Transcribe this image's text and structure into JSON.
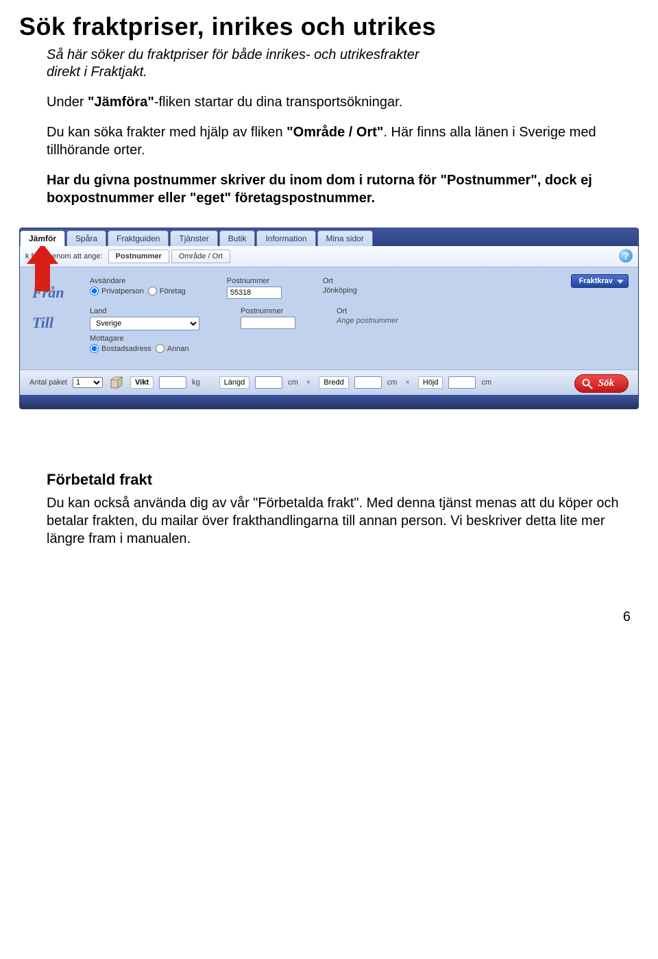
{
  "title": "Sök fraktpriser, inrikes och utrikes",
  "intro_line1": "Så här söker du fraktpriser för både inrikes- och utrikesfrakter",
  "intro_line2": "direkt i Fraktjakt.",
  "p1_a": "Under ",
  "p1_b": "\"Jämföra\"",
  "p1_c": "-fliken startar du dina transportsökningar.",
  "p2_a": "Du kan söka frakter med hjälp av fliken ",
  "p2_b": "\"Område / Ort\"",
  "p2_c": ". Här finns alla länen i Sverige med tillhörande orter.",
  "p3_a": "Har du givna postnummer skriver du inom dom i rutorna för ",
  "p3_b": "\"Postnummer\"",
  "p3_c": ", dock ej boxpostnummer eller \"eget\" företagspostnummer.",
  "app": {
    "tabs": [
      "Jämför",
      "Spåra",
      "Fraktguiden",
      "Tjänster",
      "Butik",
      "Information",
      "Mina sidor"
    ],
    "active_tab": "Jämför",
    "subhint": "k frakt genom att ange:",
    "subtabs": [
      "Postnummer",
      "Område / Ort"
    ],
    "active_subtab": "Postnummer",
    "help_glyph": "?",
    "fran_label": "Från",
    "till_label": "Till",
    "avsandare_label": "Avsändare",
    "radio_privat": "Privatperson",
    "radio_foretag": "Företag",
    "postnummer_label": "Postnummer",
    "postnummer_value": "55318",
    "ort_label": "Ort",
    "ort_value": "Jönköping",
    "land_label": "Land",
    "land_value": "Sverige",
    "to_postnummer_label": "Postnummer",
    "to_ort_label": "Ort",
    "to_ort_hint": "Ange postnummer",
    "mottagare_label": "Mottagare",
    "radio_bostad": "Bostadsadress",
    "radio_annan": "Annan",
    "fraktkrav_label": "Fraktkrav",
    "antal_label": "Antal paket",
    "antal_value": "1",
    "vikt_label": "Vikt",
    "vikt_unit": "kg",
    "langd_label": "Längd",
    "bredd_label": "Bredd",
    "hojd_label": "Höjd",
    "dim_unit": "cm",
    "sok_label": "Sök"
  },
  "forbetald_heading": "Förbetald frakt",
  "forbetald_body": "Du kan också använda dig av vår \"Förbetalda frakt\". Med denna tjänst menas att du köper och betalar frakten, du mailar över frakthandlingarna till annan person. Vi beskriver detta lite mer längre fram i manualen.",
  "page_number": "6"
}
